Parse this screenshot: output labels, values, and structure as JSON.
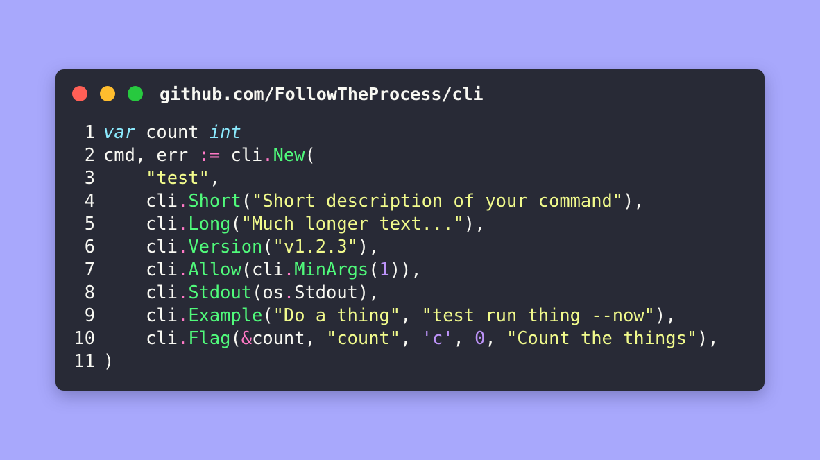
{
  "window": {
    "title": "github.com/FollowTheProcess/cli",
    "controls": [
      "close",
      "minimize",
      "maximize"
    ]
  },
  "colors": {
    "background": "#a8a8fc",
    "window": "#282a36",
    "keyword": "#8be9fd",
    "operator": "#ff79c6",
    "function": "#50fa7b",
    "string": "#f1fa8c",
    "number": "#bd93f9",
    "text": "#f8f8f2"
  },
  "code": {
    "lines": [
      {
        "number": "1",
        "tokens": [
          {
            "t": "var",
            "k": "kw"
          },
          {
            "t": " count ",
            "k": "txt"
          },
          {
            "t": "int",
            "k": "kw"
          }
        ]
      },
      {
        "number": "2",
        "tokens": [
          {
            "t": "cmd, err ",
            "k": "txt"
          },
          {
            "t": ":=",
            "k": "op"
          },
          {
            "t": " cli",
            "k": "txt"
          },
          {
            "t": ".",
            "k": "op"
          },
          {
            "t": "New",
            "k": "fn"
          },
          {
            "t": "(",
            "k": "txt"
          }
        ]
      },
      {
        "number": "3",
        "tokens": [
          {
            "t": "    ",
            "k": "txt"
          },
          {
            "t": "\"test\"",
            "k": "str"
          },
          {
            "t": ",",
            "k": "txt"
          }
        ]
      },
      {
        "number": "4",
        "tokens": [
          {
            "t": "    cli",
            "k": "txt"
          },
          {
            "t": ".",
            "k": "op"
          },
          {
            "t": "Short",
            "k": "fn"
          },
          {
            "t": "(",
            "k": "txt"
          },
          {
            "t": "\"Short description of your command\"",
            "k": "str"
          },
          {
            "t": "),",
            "k": "txt"
          }
        ]
      },
      {
        "number": "5",
        "tokens": [
          {
            "t": "    cli",
            "k": "txt"
          },
          {
            "t": ".",
            "k": "op"
          },
          {
            "t": "Long",
            "k": "fn"
          },
          {
            "t": "(",
            "k": "txt"
          },
          {
            "t": "\"Much longer text...\"",
            "k": "str"
          },
          {
            "t": "),",
            "k": "txt"
          }
        ]
      },
      {
        "number": "6",
        "tokens": [
          {
            "t": "    cli",
            "k": "txt"
          },
          {
            "t": ".",
            "k": "op"
          },
          {
            "t": "Version",
            "k": "fn"
          },
          {
            "t": "(",
            "k": "txt"
          },
          {
            "t": "\"v1.2.3\"",
            "k": "str"
          },
          {
            "t": "),",
            "k": "txt"
          }
        ]
      },
      {
        "number": "7",
        "tokens": [
          {
            "t": "    cli",
            "k": "txt"
          },
          {
            "t": ".",
            "k": "op"
          },
          {
            "t": "Allow",
            "k": "fn"
          },
          {
            "t": "(cli",
            "k": "txt"
          },
          {
            "t": ".",
            "k": "op"
          },
          {
            "t": "MinArgs",
            "k": "fn"
          },
          {
            "t": "(",
            "k": "txt"
          },
          {
            "t": "1",
            "k": "num"
          },
          {
            "t": ")),",
            "k": "txt"
          }
        ]
      },
      {
        "number": "8",
        "tokens": [
          {
            "t": "    cli",
            "k": "txt"
          },
          {
            "t": ".",
            "k": "op"
          },
          {
            "t": "Stdout",
            "k": "fn"
          },
          {
            "t": "(os",
            "k": "txt"
          },
          {
            "t": ".",
            "k": "op"
          },
          {
            "t": "Stdout),",
            "k": "txt"
          }
        ]
      },
      {
        "number": "9",
        "tokens": [
          {
            "t": "    cli",
            "k": "txt"
          },
          {
            "t": ".",
            "k": "op"
          },
          {
            "t": "Example",
            "k": "fn"
          },
          {
            "t": "(",
            "k": "txt"
          },
          {
            "t": "\"Do a thing\"",
            "k": "str"
          },
          {
            "t": ", ",
            "k": "txt"
          },
          {
            "t": "\"test run thing --now\"",
            "k": "str"
          },
          {
            "t": "),",
            "k": "txt"
          }
        ]
      },
      {
        "number": "10",
        "tokens": [
          {
            "t": "    cli",
            "k": "txt"
          },
          {
            "t": ".",
            "k": "op"
          },
          {
            "t": "Flag",
            "k": "fn"
          },
          {
            "t": "(",
            "k": "txt"
          },
          {
            "t": "&",
            "k": "op"
          },
          {
            "t": "count, ",
            "k": "txt"
          },
          {
            "t": "\"count\"",
            "k": "str"
          },
          {
            "t": ", ",
            "k": "txt"
          },
          {
            "t": "'c'",
            "k": "chr"
          },
          {
            "t": ", ",
            "k": "txt"
          },
          {
            "t": "0",
            "k": "num"
          },
          {
            "t": ", ",
            "k": "txt"
          },
          {
            "t": "\"Count the things\"",
            "k": "str"
          },
          {
            "t": "),",
            "k": "txt"
          }
        ]
      },
      {
        "number": "11",
        "tokens": [
          {
            "t": ")",
            "k": "txt"
          }
        ]
      }
    ]
  }
}
